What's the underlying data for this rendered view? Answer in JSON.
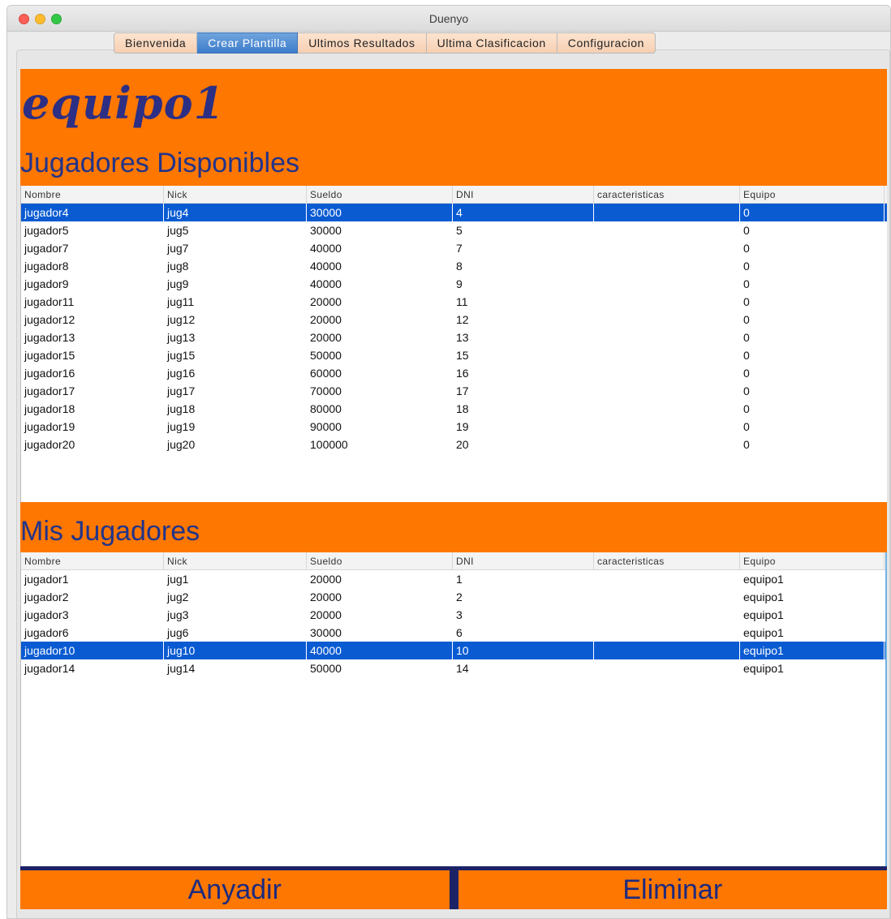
{
  "window": {
    "title": "Duenyo"
  },
  "tabs": [
    {
      "label": "Bienvenida",
      "active": false
    },
    {
      "label": "Crear Plantilla",
      "active": true
    },
    {
      "label": "Ultimos Resultados",
      "active": false
    },
    {
      "label": "Ultima Clasificacion",
      "active": false
    },
    {
      "label": "Configuracion",
      "active": false
    }
  ],
  "team": {
    "name": "equipo1"
  },
  "available": {
    "title": "Jugadores Disponibles",
    "columns": [
      "Nombre",
      "Nick",
      "Sueldo",
      "DNI",
      "caracteristicas",
      "Equipo"
    ],
    "rows": [
      [
        "jugador4",
        "jug4",
        "30000",
        "4",
        "",
        "0"
      ],
      [
        "jugador5",
        "jug5",
        "30000",
        "5",
        "",
        "0"
      ],
      [
        "jugador7",
        "jug7",
        "40000",
        "7",
        "",
        "0"
      ],
      [
        "jugador8",
        "jug8",
        "40000",
        "8",
        "",
        "0"
      ],
      [
        "jugador9",
        "jug9",
        "40000",
        "9",
        "",
        "0"
      ],
      [
        "jugador11",
        "jug11",
        "20000",
        "11",
        "",
        "0"
      ],
      [
        "jugador12",
        "jug12",
        "20000",
        "12",
        "",
        "0"
      ],
      [
        "jugador13",
        "jug13",
        "20000",
        "13",
        "",
        "0"
      ],
      [
        "jugador15",
        "jug15",
        "50000",
        "15",
        "",
        "0"
      ],
      [
        "jugador16",
        "jug16",
        "60000",
        "16",
        "",
        "0"
      ],
      [
        "jugador17",
        "jug17",
        "70000",
        "17",
        "",
        "0"
      ],
      [
        "jugador18",
        "jug18",
        "80000",
        "18",
        "",
        "0"
      ],
      [
        "jugador19",
        "jug19",
        "90000",
        "19",
        "",
        "0"
      ],
      [
        "jugador20",
        "jug20",
        "100000",
        "20",
        "",
        "0"
      ]
    ],
    "selected_row": 0
  },
  "mine": {
    "title": "Mis Jugadores",
    "columns": [
      "Nombre",
      "Nick",
      "Sueldo",
      "DNI",
      "caracteristicas",
      "Equipo"
    ],
    "rows": [
      [
        "jugador1",
        "jug1",
        "20000",
        "1",
        "",
        "equipo1"
      ],
      [
        "jugador2",
        "jug2",
        "20000",
        "2",
        "",
        "equipo1"
      ],
      [
        "jugador3",
        "jug3",
        "20000",
        "3",
        "",
        "equipo1"
      ],
      [
        "jugador6",
        "jug6",
        "30000",
        "6",
        "",
        "equipo1"
      ],
      [
        "jugador10",
        "jug10",
        "40000",
        "10",
        "",
        "equipo1"
      ],
      [
        "jugador14",
        "jug14",
        "50000",
        "14",
        "",
        "equipo1"
      ]
    ],
    "selected_row": 4
  },
  "buttons": {
    "add": "Anyadir",
    "remove": "Eliminar"
  },
  "colors": {
    "accent": "#fe7700",
    "title_text": "#22348a",
    "selection": "#0a5bd2"
  }
}
